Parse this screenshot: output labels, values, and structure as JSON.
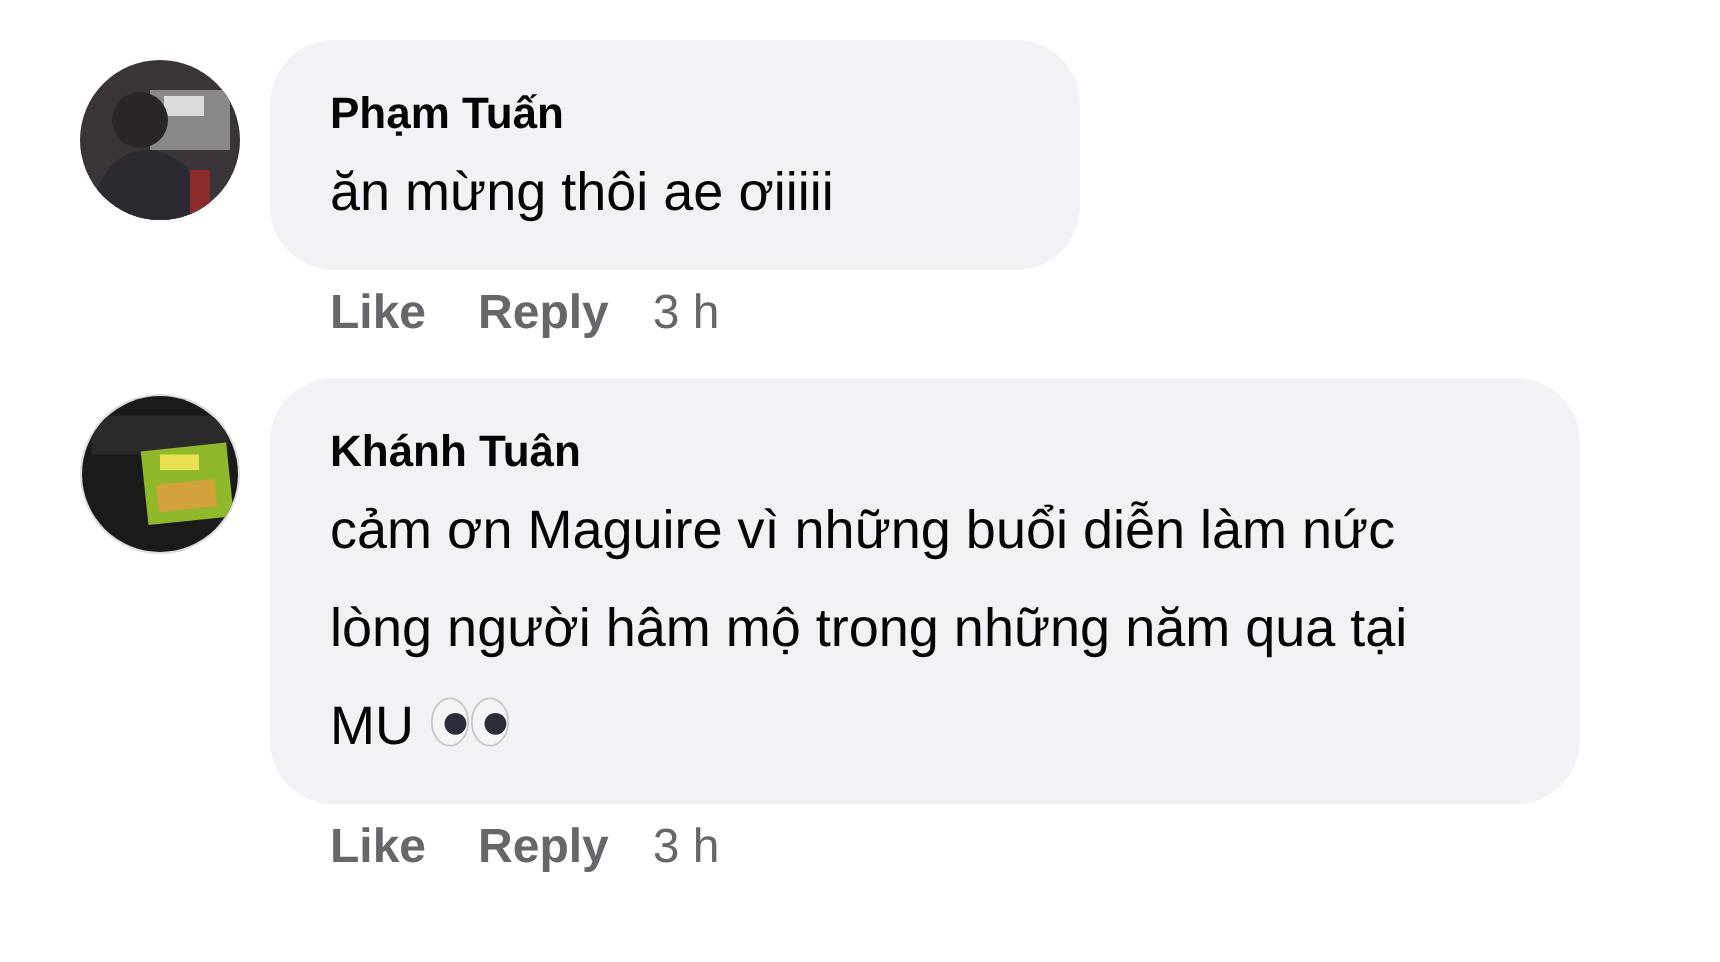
{
  "comments": [
    {
      "author": "Phạm Tuấn",
      "text": "ăn mừng thôi ae ơiiiii",
      "emoji_eyes": false,
      "actions": [
        "Like",
        "Reply"
      ],
      "time": "3 h"
    },
    {
      "author": "Khánh Tuân",
      "text": "cảm ơn Maguire vì những buổi diễn làm nức lòng người hâm mộ trong những năm qua tại MU",
      "emoji_eyes": true,
      "actions": [
        "Like",
        "Reply"
      ],
      "time": "3 h"
    }
  ]
}
